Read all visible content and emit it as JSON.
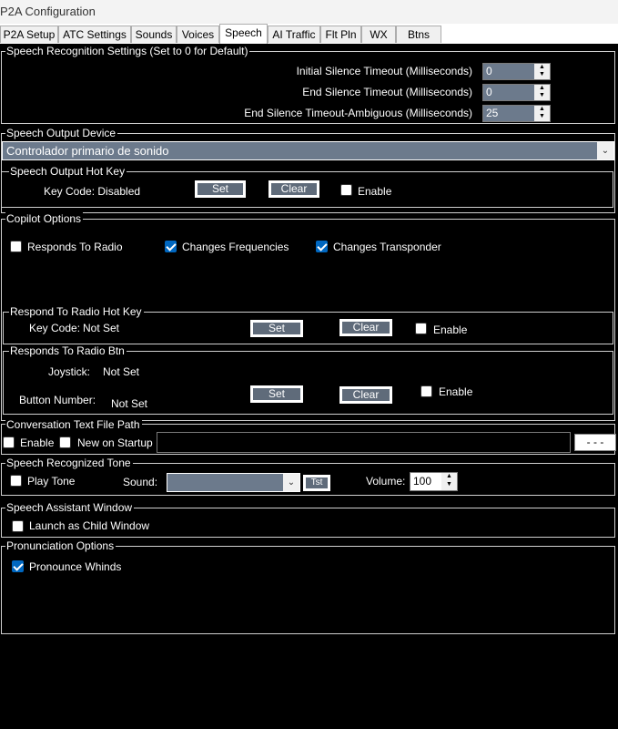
{
  "window": {
    "title": "P2A Configuration"
  },
  "tabs": [
    "P2A Setup",
    "ATC Settings",
    "Sounds",
    "Voices",
    "Speech",
    "AI Traffic",
    "Flt Pln",
    "WX",
    "Btns"
  ],
  "active_tab": "Speech",
  "recognition": {
    "legend": "Speech Recognition Settings (Set to 0 for Default)",
    "initial_label": "Initial Silence Timeout (Milliseconds)",
    "initial_value": "0",
    "end_label": "End Silence Timeout (Milliseconds)",
    "end_value": "0",
    "ambiguous_label": "End Silence Timeout-Ambiguous (Milliseconds)",
    "ambiguous_value": "25"
  },
  "output_device": {
    "legend": "Speech Output Device",
    "selected": "Controlador primario de sonido"
  },
  "output_hotkey": {
    "legend": "Speech Output Hot Key",
    "keycode_label": "Key Code: Disabled",
    "set_label": "Set",
    "clear_label": "Clear",
    "enable_label": "Enable",
    "enable_checked": false
  },
  "copilot": {
    "legend": "Copilot Options",
    "responds_label": "Responds To Radio",
    "responds_checked": false,
    "freq_label": "Changes Frequencies",
    "freq_checked": true,
    "xpdr_label": "Changes Transponder",
    "xpdr_checked": true
  },
  "radio_hotkey": {
    "legend": "Respond To Radio Hot Key",
    "keycode_label": "Key Code:",
    "keycode_value": "Not Set",
    "set_label": "Set",
    "clear_label": "Clear",
    "enable_label": "Enable",
    "enable_checked": false
  },
  "radio_btn": {
    "legend": "Responds To Radio Btn",
    "joystick_label": "Joystick:",
    "joystick_value": "Not Set",
    "button_label": "Button Number:",
    "button_value": "Not Set",
    "set_label": "Set",
    "clear_label": "Clear",
    "enable_label": "Enable",
    "enable_checked": false
  },
  "conversation": {
    "legend": "Conversation Text File Path",
    "enable_label": "Enable",
    "enable_checked": false,
    "startup_label": "New on Startup",
    "startup_checked": false,
    "path_value": "",
    "browse_label": "- - -"
  },
  "tone": {
    "legend": "Speech Recognized Tone",
    "play_label": "Play Tone",
    "play_checked": false,
    "sound_label": "Sound:",
    "sound_value": "",
    "test_label": "Tst",
    "volume_label": "Volume:",
    "volume_value": "100"
  },
  "assistant": {
    "legend": "Speech Assistant Window",
    "launch_label": "Launch as Child Window",
    "launch_checked": false
  },
  "pronunciation": {
    "legend": "Pronunciation Options",
    "whinds_label": "Pronounce Whinds",
    "whinds_checked": true
  }
}
